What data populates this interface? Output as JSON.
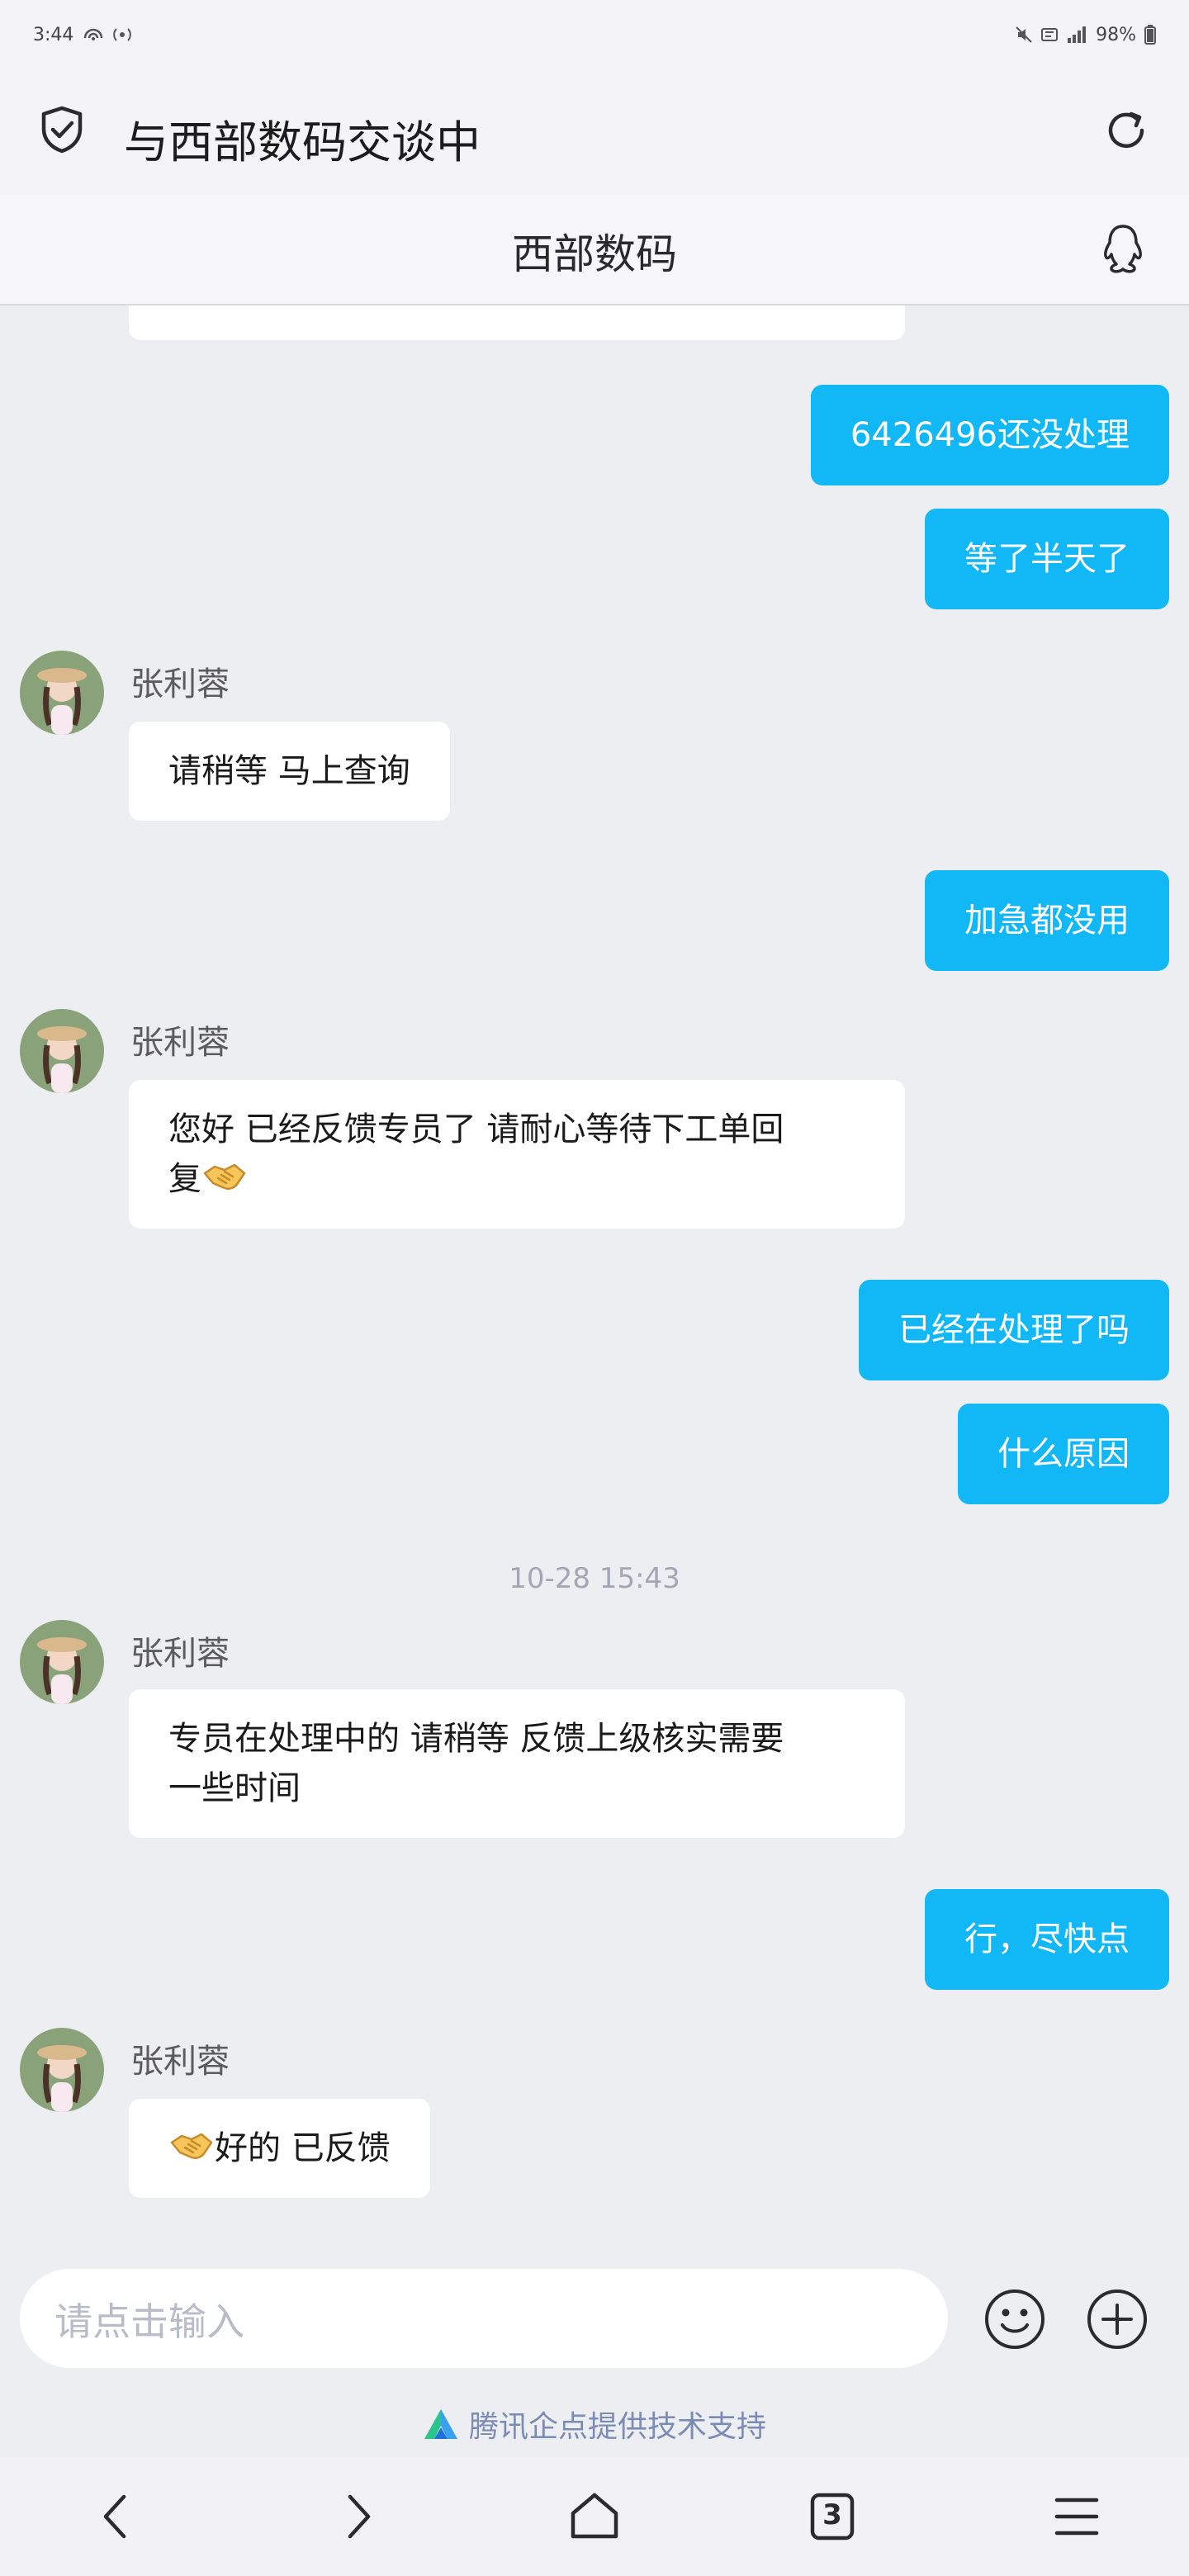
{
  "status_bar": {
    "time": "3:44",
    "battery": "98%"
  },
  "app_bar": {
    "title": "与西部数码交谈中"
  },
  "chat_header": {
    "name": "西部数码"
  },
  "messages": {
    "m1": "6426496还没处理",
    "m2": "等了半天了",
    "m3_sender": "张利蓉",
    "m3": "请稍等 马上查询",
    "m4": "加急都没用",
    "m5_sender": "张利蓉",
    "m5_line1": "您好  已经反馈专员了 请耐心等待下工单回",
    "m5_line2": "复",
    "m6": "已经在处理了吗",
    "m7": "什么原因",
    "timestamp": "10-28 15:43",
    "m8_sender": "张利蓉",
    "m8_line1": "专员在处理中的 请稍等 反馈上级核实需要",
    "m8_line2": "一些时间",
    "m9": "行，尽快点",
    "m10_sender": "张利蓉",
    "m10": "好的 已反馈"
  },
  "input": {
    "placeholder": "请点击输入"
  },
  "footer": {
    "powered_by": "腾讯企点提供技术支持"
  },
  "nav": {
    "tab_count": "3"
  },
  "colors": {
    "outgoing_bubble": "#12b7f5",
    "incoming_bubble": "#ffffff",
    "background": "#edeef2"
  },
  "icons": [
    "shield-check-icon",
    "refresh-icon",
    "qq-penguin-icon",
    "handshake-emoji",
    "smiley-icon",
    "plus-circle-icon",
    "back-icon",
    "forward-icon",
    "home-icon",
    "tabs-icon",
    "menu-icon"
  ]
}
